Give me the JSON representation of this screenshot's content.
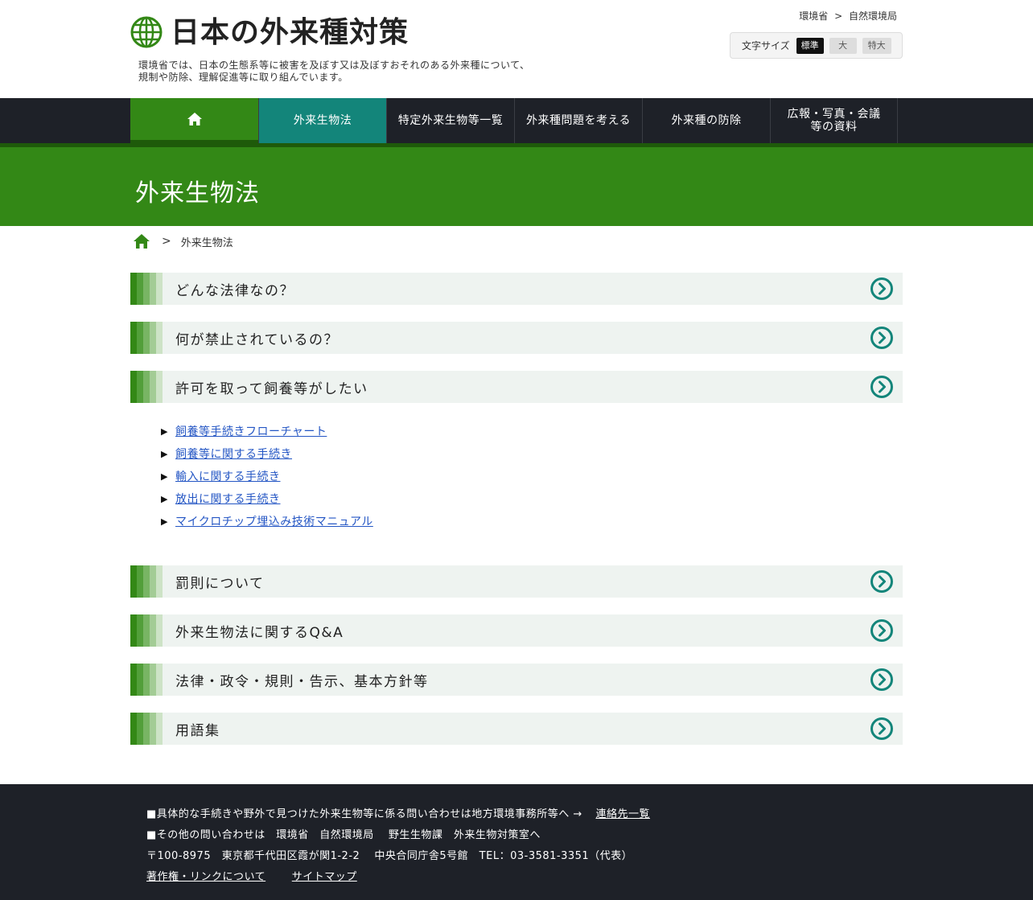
{
  "header": {
    "logo_text": "日本の外来種対策",
    "tagline_line1": "環境省では、日本の生態系等に被害を及ぼす又は及ぼすおそれのある外来種について、",
    "tagline_line2": "規制や防除、理解促進等に取り組んでいます。",
    "top_links": [
      "環境省",
      ">",
      "自然環境局"
    ],
    "font_size": {
      "label": "文字サイズ",
      "options": [
        "標準",
        "大",
        "特大"
      ],
      "selected": "標準"
    }
  },
  "nav": {
    "home_icon": "home-icon",
    "items": [
      "外来生物法",
      "特定外来生物等一覧",
      "外来種問題を考える",
      "外来種の防除",
      "広報・写真・会議",
      "等の資料"
    ],
    "current": "外来生物法"
  },
  "hero": {
    "title": "外来生物法"
  },
  "breadcrumb": {
    "separator": ">",
    "current": "外来生物法"
  },
  "sections": [
    "どんな法律なの？",
    "何が禁止されているの？",
    "許可を取って飼養等がしたい",
    "罰則について",
    "外来生物法に関するQ&A",
    "法律・政令・規則・告示、基本方針等",
    "用語集"
  ],
  "sub_links": {
    "arrow": "▶",
    "items": [
      "飼養等手続きフローチャート",
      "飼養等に関する手続き",
      "輸入に関する手続き",
      "放出に関する手続き",
      "マイクロチップ埋込み技術マニュアル"
    ]
  },
  "footer": {
    "line1_text": "■具体的な手続きや野外で見つけた外来生物等に係る問い合わせは地方環境事務所等へ →",
    "line1_link": "連絡先一覧",
    "line2_text": "■その他の問い合わせは　環境省　自然環境局　 野生生物課　外来生物対策室へ",
    "line3_text": "〒100-8975　東京都千代田区霞が関1-2-2　 中央合同庁舎5号館　TEL：03-3581-3351（代表）",
    "link_copyright": "著作権・リンクについて",
    "link_sitemap": "サイトマップ"
  },
  "colors": {
    "brand_green": "#338816",
    "dark_green": "#1e5a0a",
    "teal": "#13857a",
    "nav_dark": "#1e2128",
    "row_bg": "#eef3f0",
    "link_blue": "#2456c4"
  }
}
